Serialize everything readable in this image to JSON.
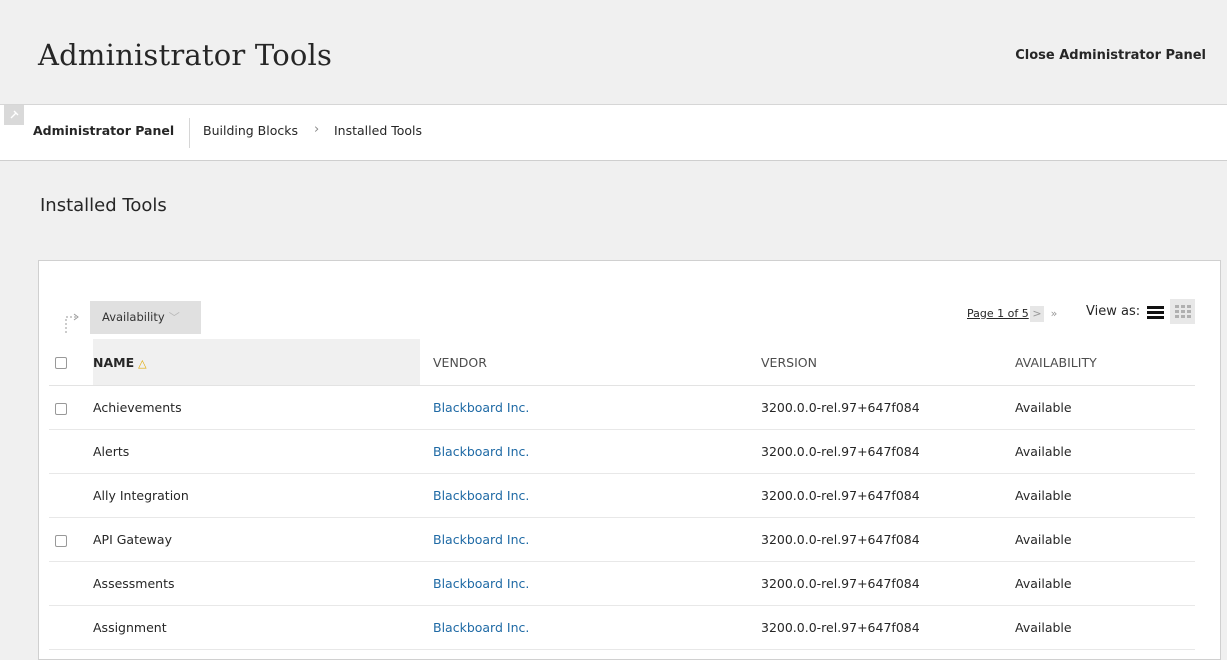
{
  "header": {
    "title": "Administrator Tools",
    "close_label": "Close Administrator Panel"
  },
  "breadcrumb": {
    "root": "Administrator Panel",
    "items": [
      "Building Blocks",
      "Installed Tools"
    ],
    "separator": "›"
  },
  "page": {
    "title": "Installed Tools"
  },
  "toolbar": {
    "availability_label": "Availability",
    "pager_text": "Page 1 of 5",
    "next_label": ">",
    "last_label": "»",
    "view_as_label": "View as:"
  },
  "table": {
    "columns": [
      "NAME",
      "VENDOR",
      "VERSION",
      "AVAILABILITY"
    ],
    "rows": [
      {
        "name": "Achievements",
        "vendor": "Blackboard Inc.",
        "version": "3200.0.0-rel.97+647f084",
        "availability": "Available",
        "checkbox": true
      },
      {
        "name": "Alerts",
        "vendor": "Blackboard Inc.",
        "version": "3200.0.0-rel.97+647f084",
        "availability": "Available",
        "checkbox": false
      },
      {
        "name": "Ally Integration",
        "vendor": "Blackboard Inc.",
        "version": "3200.0.0-rel.97+647f084",
        "availability": "Available",
        "checkbox": false
      },
      {
        "name": "API Gateway",
        "vendor": "Blackboard Inc.",
        "version": "3200.0.0-rel.97+647f084",
        "availability": "Available",
        "checkbox": true
      },
      {
        "name": "Assessments",
        "vendor": "Blackboard Inc.",
        "version": "3200.0.0-rel.97+647f084",
        "availability": "Available",
        "checkbox": false
      },
      {
        "name": "Assignment",
        "vendor": "Blackboard Inc.",
        "version": "3200.0.0-rel.97+647f084",
        "availability": "Available",
        "checkbox": false
      }
    ]
  },
  "colors": {
    "link": "#1f6aa5",
    "sort_indicator": "#e0a800",
    "background": "#f0f0f0"
  },
  "icons": {
    "pin": "pin-icon",
    "sort": "sort-ascending-icon",
    "list_view": "list-view-icon",
    "grid_view": "grid-view-icon"
  }
}
